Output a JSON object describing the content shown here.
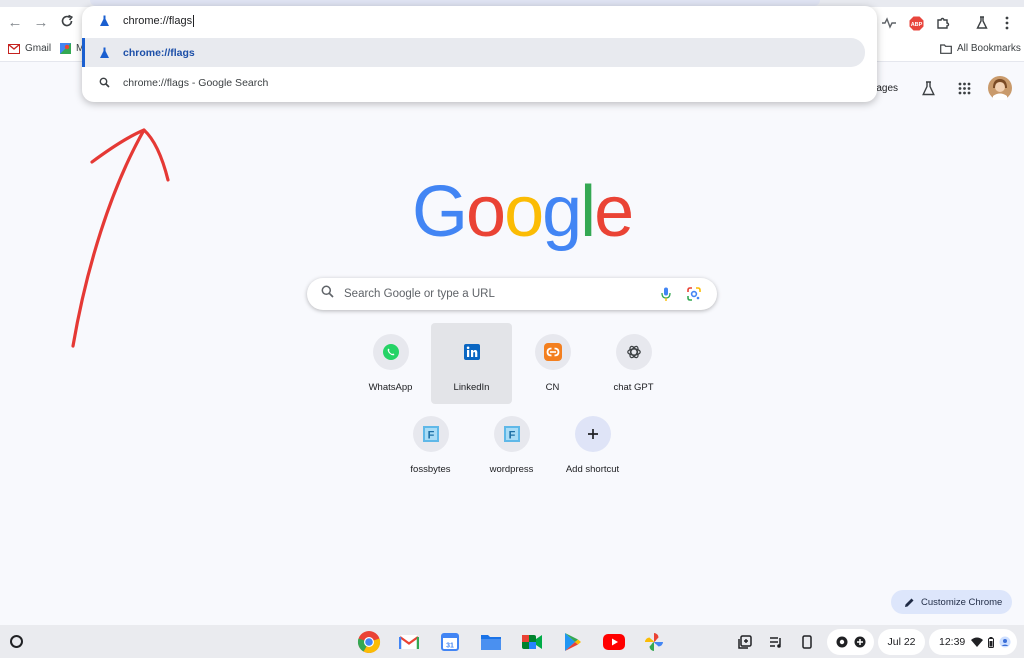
{
  "browser": {
    "omnibox": {
      "value": "chrome://flags",
      "suggestions": [
        {
          "text": "chrome://flags",
          "suffix": ""
        },
        {
          "text": "chrome://flags",
          "suffix": " - Google Search"
        }
      ]
    },
    "bookmarks": {
      "items": [
        {
          "label": "Gmail"
        },
        {
          "label": "M"
        }
      ],
      "all_bookmarks": "All Bookmarks"
    },
    "ntp": {
      "images_link": "mages",
      "logo": "Google",
      "search_placeholder": "Search Google or type a URL",
      "shortcuts": [
        {
          "label": "WhatsApp",
          "icon": "whatsapp-icon"
        },
        {
          "label": "LinkedIn",
          "icon": "linkedin-icon"
        },
        {
          "label": "CN",
          "icon": "cn-icon"
        },
        {
          "label": "chat GPT",
          "icon": "openai-icon"
        },
        {
          "label": "fossbytes",
          "icon": "fossbytes-icon"
        },
        {
          "label": "wordpress",
          "icon": "wordpress-icon"
        },
        {
          "label": "Add shortcut",
          "icon": "plus-icon"
        }
      ],
      "customize_label": "Customize Chrome"
    }
  },
  "shelf": {
    "date": "Jul 22",
    "time": "12:39"
  },
  "colors": {
    "google_blue": "#4285f4",
    "google_red": "#ea4335",
    "google_yellow": "#fbbc05",
    "google_green": "#34a853",
    "annotation_arrow": "#e53935"
  }
}
